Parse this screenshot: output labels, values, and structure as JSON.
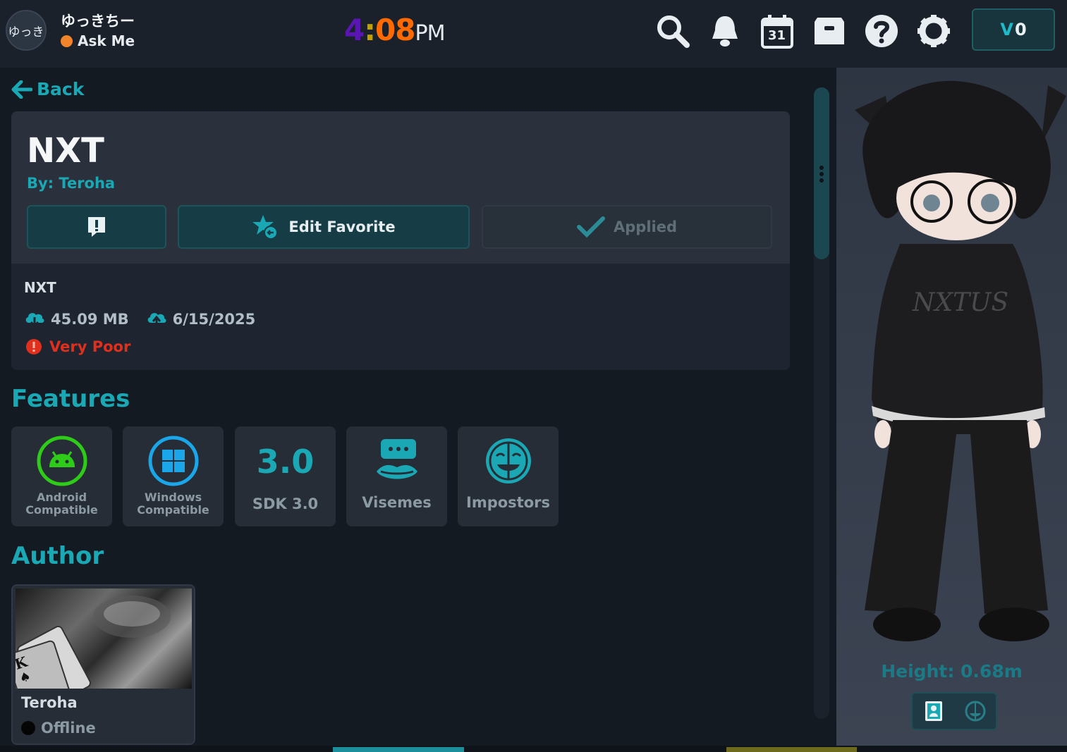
{
  "header": {
    "avatar_text": "ゆっき",
    "username": "ゆっきちー",
    "status": "Ask Me",
    "clock": {
      "hour": "4",
      "colon": ":",
      "minutes": "08",
      "ampm": "PM"
    },
    "currency": {
      "symbol": "V",
      "amount": "0"
    },
    "icons": [
      "search-icon",
      "bell-icon",
      "calendar-icon",
      "inbox-icon",
      "help-icon",
      "gear-icon"
    ],
    "calendar_day": "31"
  },
  "nav": {
    "back_label": "Back"
  },
  "avatar_info": {
    "name": "NXT",
    "by_label": "By: Teroha",
    "buttons": {
      "edit_favorite": "Edit Favorite",
      "applied": "Applied"
    },
    "detail_name": "NXT",
    "size": "45.09 MB",
    "date": "6/15/2025",
    "rating": "Very Poor"
  },
  "features": {
    "title": "Features",
    "items": [
      {
        "label": "Android Compatible",
        "icon": "android-icon"
      },
      {
        "label": "Windows Compatible",
        "icon": "windows-icon"
      },
      {
        "big": "3.0",
        "label": "SDK 3.0",
        "icon": "sdk-icon"
      },
      {
        "label": "Visemes",
        "icon": "visemes-icon"
      },
      {
        "label": "Impostors",
        "icon": "impostors-icon"
      }
    ]
  },
  "author": {
    "title": "Author",
    "name": "Teroha",
    "status": "Offline"
  },
  "preview": {
    "height": "Height: 0.68m"
  },
  "colors": {
    "accent": "#1ba8b5",
    "rating_bad": "#e0301d",
    "status_orange": "#f2842a"
  }
}
